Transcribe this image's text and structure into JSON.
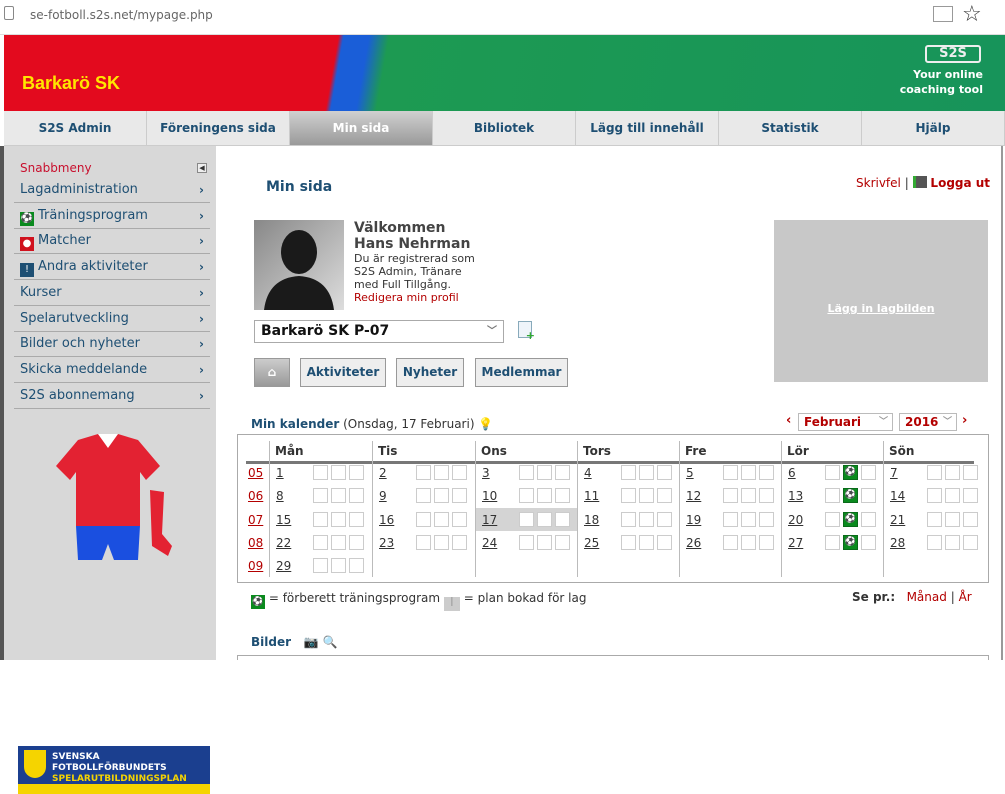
{
  "browser": {
    "url": "se-fotboll.s2s.net/mypage.php"
  },
  "header": {
    "club": "Barkarö SK",
    "logo": "S2S",
    "tagline_1": "Your online",
    "tagline_2": "coaching tool",
    "colors": {
      "red": "#e30a1e",
      "green": "#17945a",
      "blue": "#1a5ed8"
    }
  },
  "nav": {
    "tabs": [
      {
        "label": "S2S Admin"
      },
      {
        "label": "Föreningens sida"
      },
      {
        "label": "Min sida",
        "active": true
      },
      {
        "label": "Bibliotek"
      },
      {
        "label": "Lägg till innehåll"
      },
      {
        "label": "Statistik"
      },
      {
        "label": "Hjälp"
      }
    ]
  },
  "sidebar": {
    "heading": "Snabbmeny",
    "items": [
      {
        "label": "Lagadministration",
        "icon": ""
      },
      {
        "label": "Träningsprogram",
        "icon": "football-icon"
      },
      {
        "label": "Matcher",
        "icon": "match-icon"
      },
      {
        "label": "Andra aktiviteter",
        "icon": "exclamation-icon"
      },
      {
        "label": "Kurser",
        "icon": ""
      },
      {
        "label": "Spelarutveckling",
        "icon": ""
      },
      {
        "label": "Bilder och nyheter",
        "icon": ""
      },
      {
        "label": "Skicka meddelande",
        "icon": ""
      },
      {
        "label": "S2S abonnemang",
        "icon": ""
      }
    ],
    "sff_line1": "SVENSKA FOTBOLLFÖRBUNDETS",
    "sff_line2": "SPELARUTBILDNINGSPLAN"
  },
  "main": {
    "title": "Min sida",
    "skrivfel": "Skrivfel",
    "separator": "|",
    "logout": "Logga ut",
    "welcome": "Välkommen",
    "name": "Hans Nehrman",
    "role_1": "Du är registrerad som",
    "role_2": "S2S Admin, Tränare",
    "role_3": "med Full Tillgång.",
    "edit_profile": "Redigera min profil",
    "team_select": "Barkarö SK P-07",
    "buttons": {
      "aktiviteter": "Aktiviteter",
      "nyheter": "Nyheter",
      "medlemmar": "Medlemmar"
    },
    "team_picture": "Lägg in lagbilden"
  },
  "calendar": {
    "title": "Min kalender",
    "date": "(Onsdag, 17 Februari)",
    "month": "Februari",
    "year": "2016",
    "prev": "‹",
    "next": "›",
    "days": [
      "Mån",
      "Tis",
      "Ons",
      "Tors",
      "Fre",
      "Lör",
      "Sön"
    ],
    "weeks": [
      {
        "week": "05",
        "days": [
          "1",
          "2",
          "3",
          "4",
          "5",
          "6",
          "7"
        ]
      },
      {
        "week": "06",
        "days": [
          "8",
          "9",
          "10",
          "11",
          "12",
          "13",
          "14"
        ]
      },
      {
        "week": "07",
        "days": [
          "15",
          "16",
          "17",
          "18",
          "19",
          "20",
          "21"
        ]
      },
      {
        "week": "08",
        "days": [
          "22",
          "23",
          "24",
          "25",
          "26",
          "27",
          "28"
        ]
      },
      {
        "week": "09",
        "days": [
          "29"
        ]
      }
    ],
    "today": "17",
    "training_days": [
      "6",
      "13",
      "20",
      "27"
    ],
    "legend_training": "= förberett träningsprogram",
    "legend_plan": "= plan bokad för lag",
    "see_per": "Se pr.:",
    "month_link": "Månad",
    "year_link": "År",
    "sep": "|"
  },
  "bilder": {
    "title": "Bilder"
  }
}
